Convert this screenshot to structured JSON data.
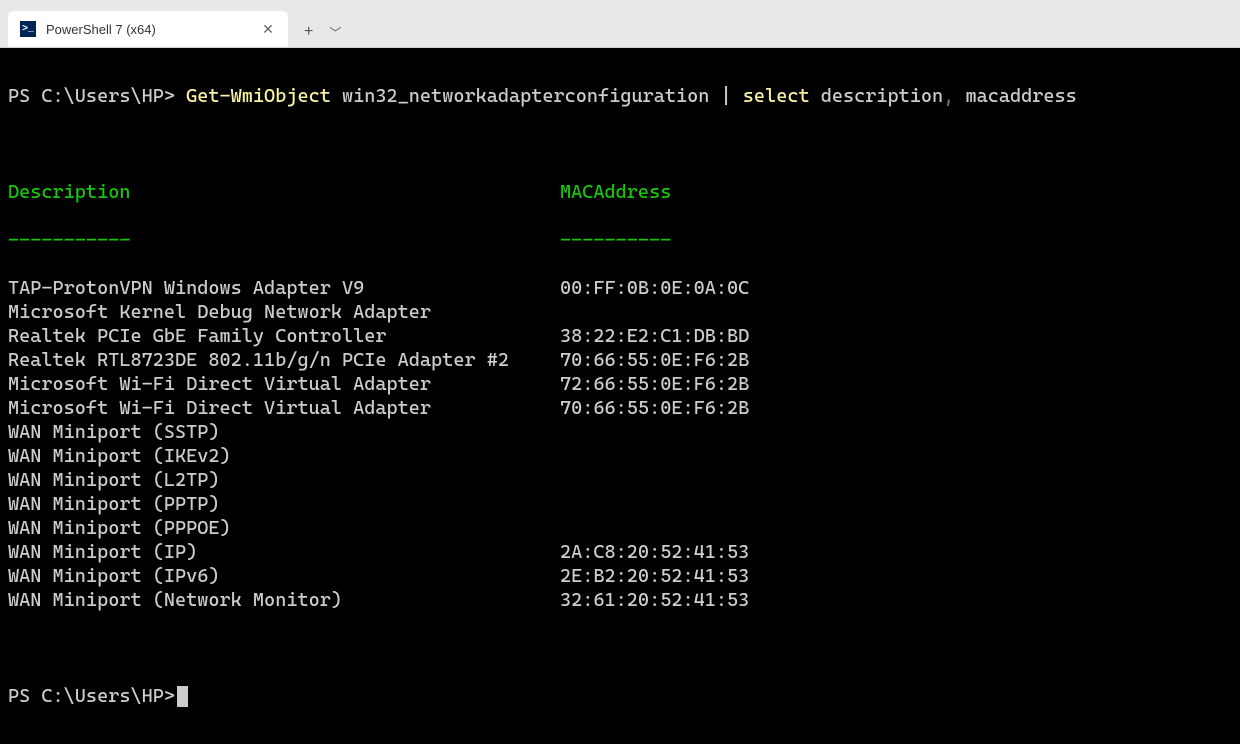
{
  "titlebar": {
    "tab_title": "PowerShell 7 (x64)",
    "tab_icon_text": ">_"
  },
  "prompt1": "PS C:\\Users\\HP> ",
  "command": {
    "seg1": "Get-WmiObject",
    "seg2": " win32_networkadapterconfiguration ",
    "seg3": "|",
    "seg4": " ",
    "seg5": "select",
    "seg6": " description",
    "seg7": ",",
    "seg8": " macaddress"
  },
  "headers": {
    "col1": "Description",
    "col2": "MACAddress",
    "rule1": "-----------",
    "rule2": "----------"
  },
  "rows": [
    {
      "desc": "TAP-ProtonVPN Windows Adapter V9",
      "mac": "00:FF:0B:0E:0A:0C"
    },
    {
      "desc": "Microsoft Kernel Debug Network Adapter",
      "mac": ""
    },
    {
      "desc": "Realtek PCIe GbE Family Controller",
      "mac": "38:22:E2:C1:DB:BD"
    },
    {
      "desc": "Realtek RTL8723DE 802.11b/g/n PCIe Adapter #2",
      "mac": "70:66:55:0E:F6:2B"
    },
    {
      "desc": "Microsoft Wi-Fi Direct Virtual Adapter",
      "mac": "72:66:55:0E:F6:2B"
    },
    {
      "desc": "Microsoft Wi-Fi Direct Virtual Adapter",
      "mac": "70:66:55:0E:F6:2B"
    },
    {
      "desc": "WAN Miniport (SSTP)",
      "mac": ""
    },
    {
      "desc": "WAN Miniport (IKEv2)",
      "mac": ""
    },
    {
      "desc": "WAN Miniport (L2TP)",
      "mac": ""
    },
    {
      "desc": "WAN Miniport (PPTP)",
      "mac": ""
    },
    {
      "desc": "WAN Miniport (PPPOE)",
      "mac": ""
    },
    {
      "desc": "WAN Miniport (IP)",
      "mac": "2A:C8:20:52:41:53"
    },
    {
      "desc": "WAN Miniport (IPv6)",
      "mac": "2E:B2:20:52:41:53"
    },
    {
      "desc": "WAN Miniport (Network Monitor)",
      "mac": "32:61:20:52:41:53"
    }
  ],
  "prompt2": "PS C:\\Users\\HP>"
}
